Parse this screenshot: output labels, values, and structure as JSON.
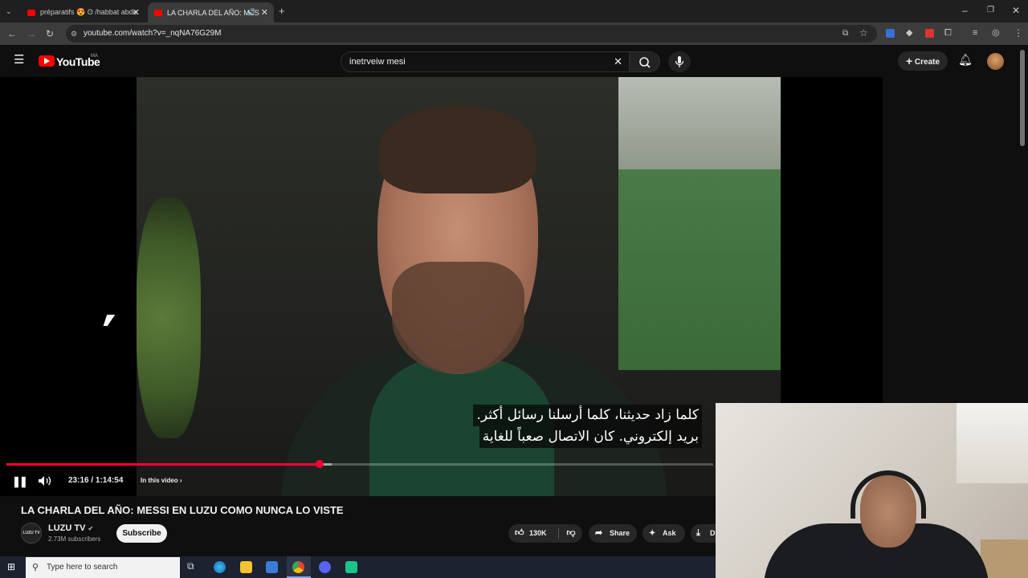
{
  "browser": {
    "tabs": [
      {
        "label": "préparatifs 😍 ʘ /habbat abde",
        "active": false
      },
      {
        "label": "LA CHARLA DEL AÑO: MES",
        "active": true
      }
    ],
    "url": "youtube.com/watch?v=_nqNA76G29M",
    "icons": [
      "tab-search-icon",
      "back-icon",
      "forward-icon",
      "reload-icon",
      "site-info-icon",
      "install-icon",
      "bookmark-star-icon",
      "extension-icon",
      "profile-icon",
      "menu-icon",
      "new-tab-icon",
      "minimize-icon",
      "maximize-icon",
      "close-icon"
    ]
  },
  "youtube": {
    "logo_text": "YouTube",
    "region": "MA",
    "search_query": "inetrveiw mesi",
    "create_label": "Create"
  },
  "video": {
    "subtitle_lines": [
      "كلما زاد حديثنا، كلما أرسلنا رسائل أكثر.",
      "بريد إلكتروني. كان الاتصال صعباً للغاية"
    ],
    "time_display": "23:16 / 1:14:54",
    "in_this_video_label": "In this video",
    "progress_fraction": 0.443,
    "buffer_fraction": 0.46
  },
  "meta": {
    "title": "LA CHARLA DEL AÑO: MESSI EN LUZU COMO NUNCA LO VISTE",
    "channel_name": "LUZU TV",
    "channel_avatar_text": "LUZU TV",
    "subscribers": "2.73M subscribers",
    "subscribe_label": "Subscribe",
    "likes": "130K",
    "share_label": "Share",
    "ask_label": "Ask",
    "download_label_partial": "D"
  },
  "taskbar": {
    "search_placeholder": "Type here to search"
  },
  "colors": {
    "accent": "#ff0033",
    "youtube_red": "#ff0000",
    "background": "#0f0f0f"
  }
}
